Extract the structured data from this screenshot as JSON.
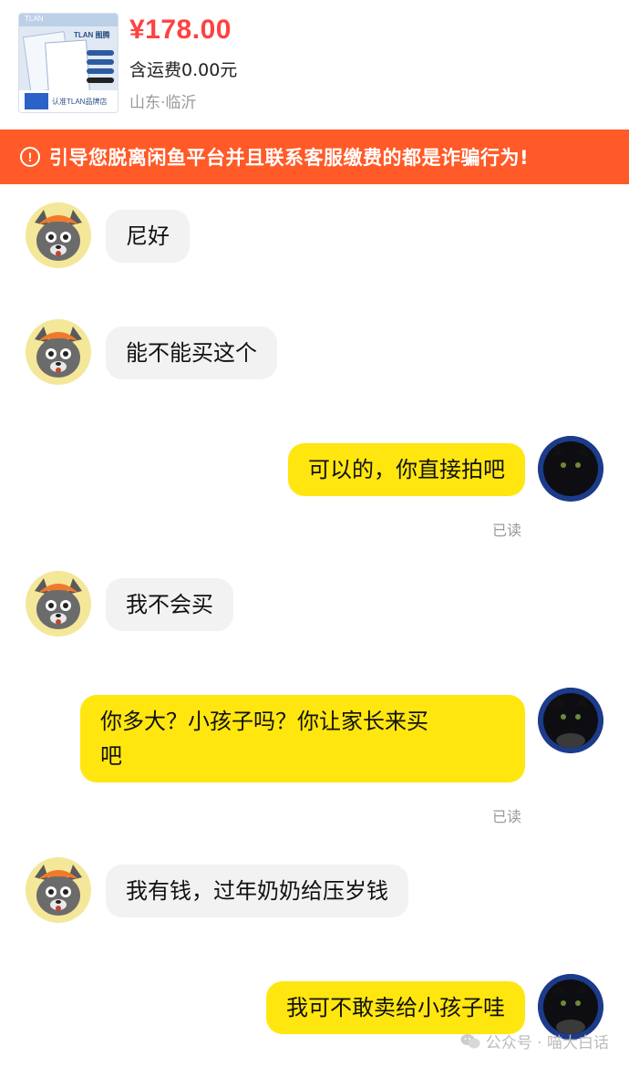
{
  "product": {
    "thumbnail_brand": "TLAN",
    "thumbnail_logo": "TLAN 图腾",
    "thumbnail_footer": "认准TLAN品牌店",
    "price": "¥178.00",
    "shipping": "含运费0.00元",
    "location": "山东·临沂"
  },
  "warning": {
    "icon": "exclamation-circle-icon",
    "text": "引导您脱离闲鱼平台并且联系客服缴费的都是诈骗行为!"
  },
  "messages": [
    {
      "side": "left",
      "text": "尼好"
    },
    {
      "side": "left",
      "text": "能不能买这个"
    },
    {
      "side": "right",
      "text": "可以的，你直接拍吧",
      "status": "已读"
    },
    {
      "side": "left",
      "text": "我不会买"
    },
    {
      "side": "right",
      "text_line1": "你多大？小孩子吗？你让家长来买",
      "text_line2": "吧",
      "status": "已读"
    },
    {
      "side": "left",
      "text": "我有钱，过年奶奶给压岁钱"
    },
    {
      "side": "right",
      "text": "我可不敢卖给小孩子哇"
    }
  ],
  "watermark": {
    "icon": "wechat-icon",
    "text": "公众号 · 喵大白话"
  },
  "colors": {
    "price": "#ff4141",
    "warning_bg": "#ff5a27",
    "own_bubble": "#ffe60f",
    "peer_bubble": "#f2f2f2"
  }
}
